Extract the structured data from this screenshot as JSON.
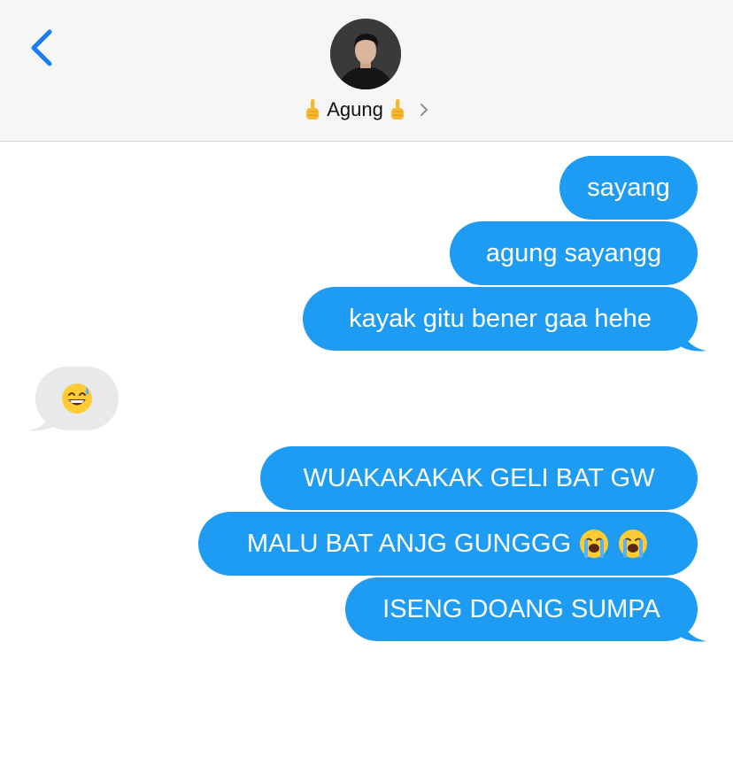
{
  "header": {
    "contact_name": "Agung",
    "contact_emoji": "finger-emoji-icon",
    "back_icon": "chevron-left-icon",
    "disclosure_icon": "chevron-right-icon"
  },
  "messages": [
    {
      "direction": "sent",
      "text": "sayang"
    },
    {
      "direction": "sent",
      "text": "agung sayangg"
    },
    {
      "direction": "sent",
      "text": "kayak gitu bener gaa hehe"
    },
    {
      "direction": "received",
      "text": "",
      "emoji": "grinning-sweat-emoji"
    },
    {
      "direction": "sent",
      "text": "WUAKAKAKAK GELI BAT GW"
    },
    {
      "direction": "sent",
      "text": "MALU BAT ANJG GUNGGG",
      "emoji": "loudly-crying-emoji x2"
    },
    {
      "direction": "sent",
      "text": "ISENG DOANG SUMPA"
    }
  ],
  "colors": {
    "sent_bubble": "#1e9bf3",
    "received_bubble": "#e9e9eb",
    "header_bg": "#f6f6f6",
    "accent": "#1a7cf5"
  }
}
